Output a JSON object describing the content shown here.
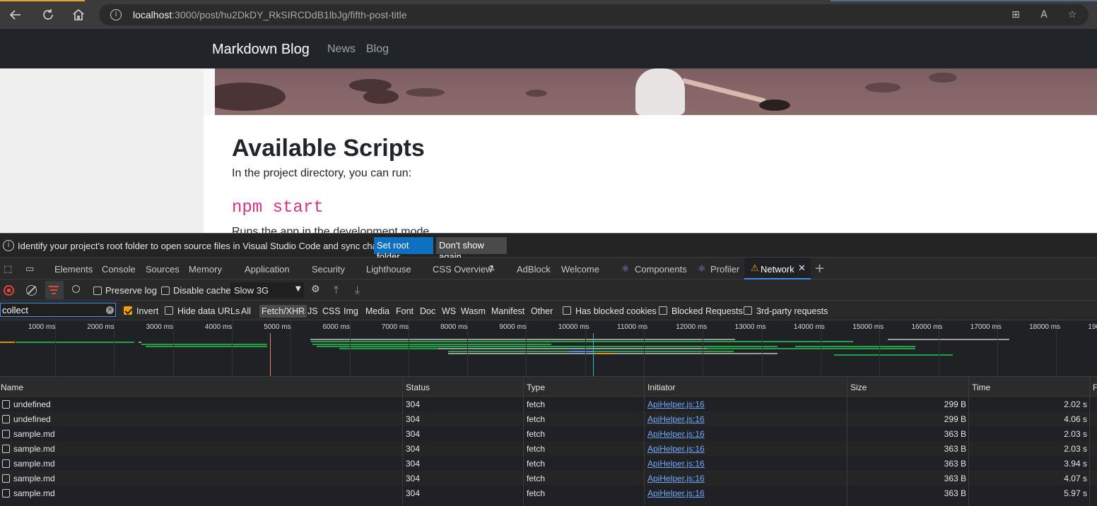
{
  "browser": {
    "url_host": "localhost",
    "url_path": ":3000/post/hu2DkDY_RkSIRCDdB1lbJg/fifth-post-title",
    "icons": [
      "back-icon",
      "refresh-icon",
      "home-icon",
      "info-icon",
      "app-available-icon",
      "read-aloud-icon",
      "favorite-star-icon"
    ]
  },
  "page": {
    "brand": "Markdown Blog",
    "nav": [
      "News",
      "Blog"
    ],
    "heading": "Available Scripts",
    "description": "In the project directory, you can run:",
    "code": "npm start",
    "runs_text": "Runs the app in the development mode."
  },
  "devtools": {
    "infobar": {
      "message": "Identify your project's root folder to open source files in Visual Studio Code and sync changes.",
      "set_root": "Set root folder",
      "dont_show": "Don't show again"
    },
    "tabs": [
      "Elements",
      "Console",
      "Sources",
      "Memory",
      "Application",
      "Security",
      "Lighthouse",
      "CSS Overview",
      "AdBlock",
      "Welcome",
      "Components",
      "Profiler",
      "Network"
    ],
    "toolbar": {
      "preserve_log": "Preserve log",
      "disable_cache": "Disable cache",
      "throttle": "Slow 3G"
    },
    "filter": {
      "value": "collect",
      "invert": "Invert",
      "hide_data_urls": "Hide data URLs",
      "types": [
        "All",
        "Fetch/XHR",
        "JS",
        "CSS",
        "Img",
        "Media",
        "Font",
        "Doc",
        "WS",
        "Wasm",
        "Manifest",
        "Other"
      ],
      "selected_type": "Fetch/XHR",
      "has_blocked_cookies": "Has blocked cookies",
      "blocked_requests": "Blocked Requests",
      "third_party": "3rd-party requests"
    },
    "timeline_ticks": [
      "1000 ms",
      "2000 ms",
      "3000 ms",
      "4000 ms",
      "5000 ms",
      "6000 ms",
      "7000 ms",
      "8000 ms",
      "9000 ms",
      "10000 ms",
      "11000 ms",
      "12000 ms",
      "13000 ms",
      "14000 ms",
      "15000 ms",
      "16000 ms",
      "17000 ms",
      "18000 ms",
      "190"
    ],
    "columns": [
      "Name",
      "Status",
      "Type",
      "Initiator",
      "Size",
      "Time",
      "F"
    ],
    "rows": [
      {
        "name": "undefined",
        "status": "304",
        "type": "fetch",
        "initiator": "ApiHelper.js:16",
        "size": "299 B",
        "time": "2.02 s"
      },
      {
        "name": "undefined",
        "status": "304",
        "type": "fetch",
        "initiator": "ApiHelper.js:16",
        "size": "299 B",
        "time": "4.06 s"
      },
      {
        "name": "sample.md",
        "status": "304",
        "type": "fetch",
        "initiator": "ApiHelper.js:16",
        "size": "363 B",
        "time": "2.03 s"
      },
      {
        "name": "sample.md",
        "status": "304",
        "type": "fetch",
        "initiator": "ApiHelper.js:16",
        "size": "363 B",
        "time": "2.03 s"
      },
      {
        "name": "sample.md",
        "status": "304",
        "type": "fetch",
        "initiator": "ApiHelper.js:16",
        "size": "363 B",
        "time": "3.94 s"
      },
      {
        "name": "sample.md",
        "status": "304",
        "type": "fetch",
        "initiator": "ApiHelper.js:16",
        "size": "363 B",
        "time": "4.07 s"
      },
      {
        "name": "sample.md",
        "status": "304",
        "type": "fetch",
        "initiator": "ApiHelper.js:16",
        "size": "363 B",
        "time": "5.97 s"
      }
    ],
    "colors": {
      "accent": "#3b8eea",
      "set_root_bg": "#0e70c0",
      "link": "#6fa8ff",
      "waterfall_green": "#1ea446",
      "waterfall_grey": "#9a9a9a"
    }
  }
}
